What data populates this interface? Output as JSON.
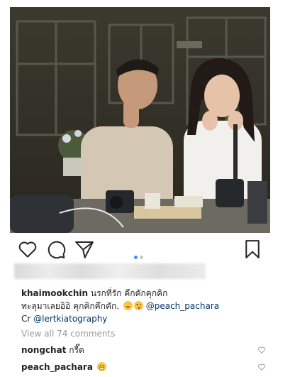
{
  "post": {
    "dots": [
      {
        "active": true
      },
      {
        "active": false
      }
    ],
    "caption": {
      "username": "khaimookchin",
      "line1": "นรกที่รัก คึกคักคุกคิก",
      "line2_text": "ทะลุมาเลยอิอิ คุกคิกคึกคัก.",
      "line2_mention": "@peach_pachara",
      "line3_prefix": "Cr",
      "line3_mention": "@lertkiatography"
    },
    "view_all": "View all 74 comments",
    "comments": [
      {
        "username": "nongchat",
        "text": "กรี๊ด"
      },
      {
        "username": "peach_pachara",
        "text": ""
      }
    ]
  },
  "colors": {
    "mention": "#003569",
    "dot_active": "#3897f0",
    "dot_inactive": "#c7c7c7"
  },
  "icons": [
    "heart-icon",
    "comment-icon",
    "share-icon",
    "bookmark-icon"
  ]
}
